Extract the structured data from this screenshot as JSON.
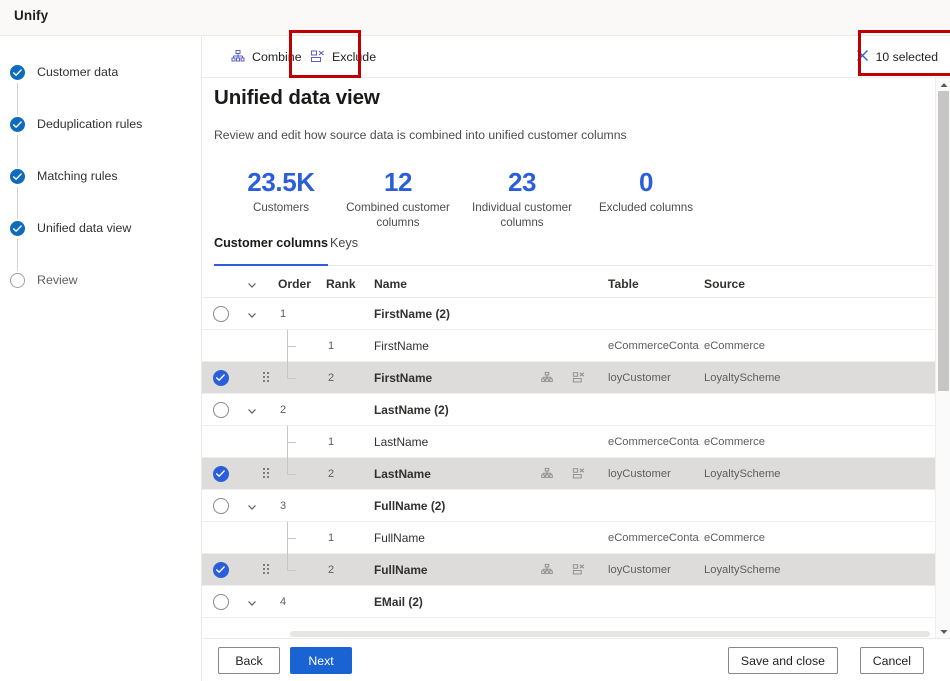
{
  "app": {
    "title": "Unify"
  },
  "sidebar": {
    "items": [
      {
        "label": "Customer data",
        "state": "done"
      },
      {
        "label": "Deduplication rules",
        "state": "done"
      },
      {
        "label": "Matching rules",
        "state": "done"
      },
      {
        "label": "Unified data view",
        "state": "done"
      },
      {
        "label": "Review",
        "state": "todo"
      }
    ]
  },
  "commandbar": {
    "combine_label": "Combine",
    "combine_icon": "combine-hierarchy-icon",
    "exclude_label": "Exclude",
    "exclude_icon": "exclude-columns-icon",
    "selected_label": "10 selected",
    "selected_icon": "close-icon",
    "highlight_color": "#c00000"
  },
  "page": {
    "title": "Unified data view",
    "subtitle": "Review and edit how source data is combined into unified customer columns"
  },
  "stats": [
    {
      "value": "23.5K",
      "label": "Customers"
    },
    {
      "value": "12",
      "label": "Combined customer columns"
    },
    {
      "value": "23",
      "label": "Individual customer columns"
    },
    {
      "value": "0",
      "label": "Excluded columns"
    }
  ],
  "tabs": [
    {
      "label": "Customer columns",
      "active": true
    },
    {
      "label": "Keys",
      "active": false
    }
  ],
  "table": {
    "headers": {
      "expand": "",
      "order": "Order",
      "rank": "Rank",
      "name": "Name",
      "table": "Table",
      "source": "Source"
    },
    "rows": [
      {
        "kind": "group",
        "order": "1",
        "rank": "",
        "name": "FirstName (2)",
        "table": "",
        "source": "",
        "selected": false
      },
      {
        "kind": "child",
        "order": "",
        "rank": "1",
        "name": "FirstName",
        "table": "eCommerceConta...",
        "source": "eCommerce",
        "selected": false
      },
      {
        "kind": "child",
        "order": "",
        "rank": "2",
        "name": "FirstName",
        "table": "loyCustomer",
        "source": "LoyaltyScheme",
        "selected": true
      },
      {
        "kind": "group",
        "order": "2",
        "rank": "",
        "name": "LastName (2)",
        "table": "",
        "source": "",
        "selected": false
      },
      {
        "kind": "child",
        "order": "",
        "rank": "1",
        "name": "LastName",
        "table": "eCommerceConta...",
        "source": "eCommerce",
        "selected": false
      },
      {
        "kind": "child",
        "order": "",
        "rank": "2",
        "name": "LastName",
        "table": "loyCustomer",
        "source": "LoyaltyScheme",
        "selected": true
      },
      {
        "kind": "group",
        "order": "3",
        "rank": "",
        "name": "FullName (2)",
        "table": "",
        "source": "",
        "selected": false
      },
      {
        "kind": "child",
        "order": "",
        "rank": "1",
        "name": "FullName",
        "table": "eCommerceConta...",
        "source": "eCommerce",
        "selected": false
      },
      {
        "kind": "child",
        "order": "",
        "rank": "2",
        "name": "FullName",
        "table": "loyCustomer",
        "source": "LoyaltyScheme",
        "selected": true
      },
      {
        "kind": "group",
        "order": "4",
        "rank": "",
        "name": "EMail (2)",
        "table": "",
        "source": "",
        "selected": false
      }
    ]
  },
  "footer": {
    "back": "Back",
    "next": "Next",
    "save_and_close": "Save and close",
    "cancel": "Cancel"
  },
  "colors": {
    "accent": "#2b5fd9",
    "primary_button": "#1964d2",
    "selected_row": "#dedcda",
    "highlight": "#c00000"
  }
}
